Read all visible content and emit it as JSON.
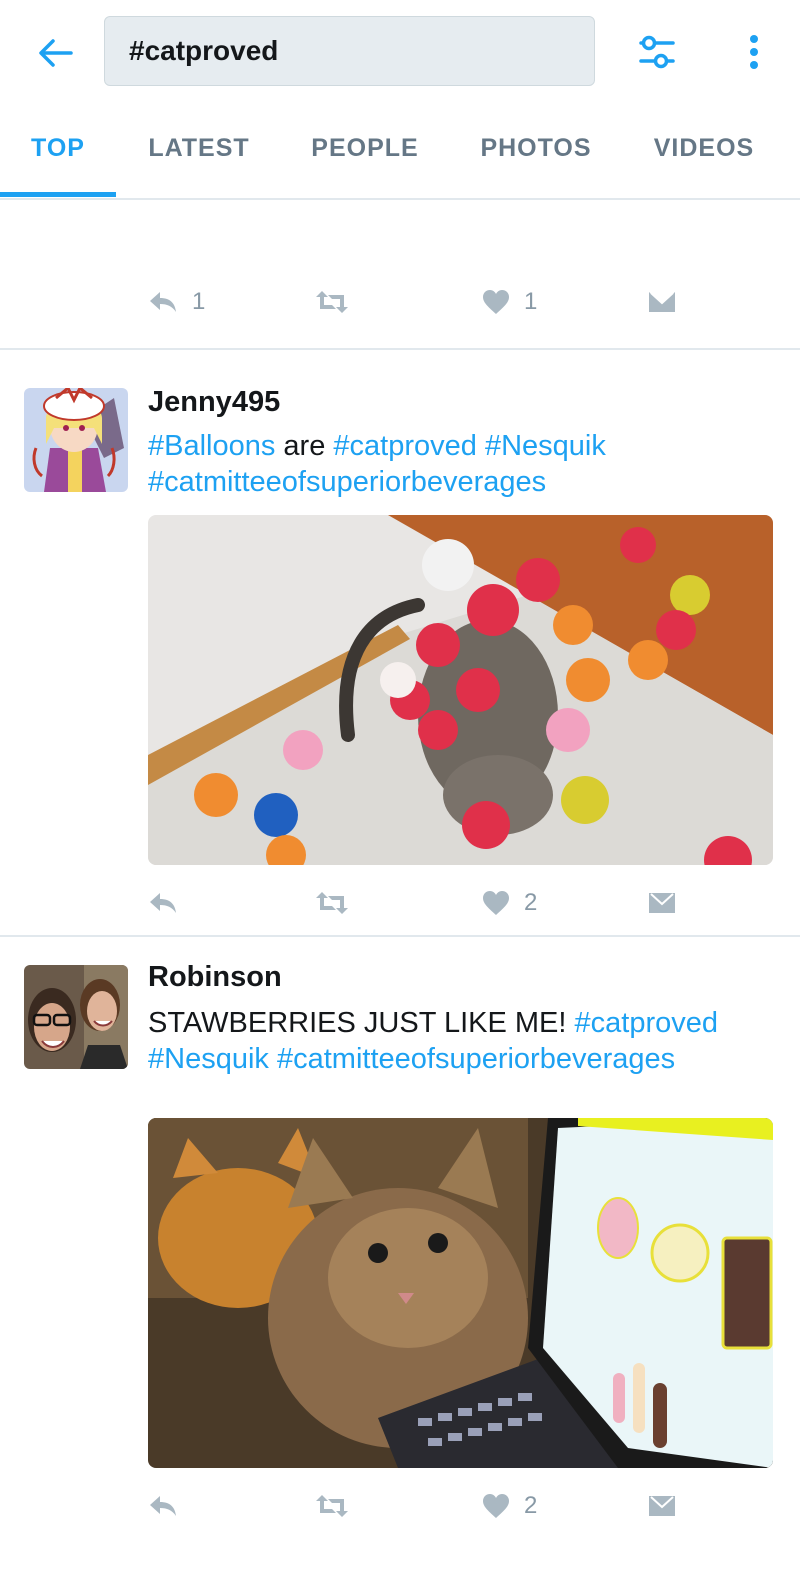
{
  "search": {
    "query": "#catproved"
  },
  "tabs": [
    {
      "label": "TOP",
      "active": true
    },
    {
      "label": "LATEST",
      "active": false
    },
    {
      "label": "PEOPLE",
      "active": false
    },
    {
      "label": "PHOTOS",
      "active": false
    },
    {
      "label": "VIDEOS",
      "active": false
    }
  ],
  "icons": {
    "back": "back-arrow-icon",
    "filter": "filter-sliders-icon",
    "more": "more-vertical-icon",
    "reply": "reply-icon",
    "retweet": "retweet-icon",
    "like": "heart-icon",
    "dm": "direct-message-icon"
  },
  "colors": {
    "accent": "#1da1f2",
    "muted": "#8899a6",
    "divider": "#e1e8ed"
  },
  "tweets": [
    {
      "actions": {
        "reply_count": "1",
        "retweet_count": "",
        "like_count": "1"
      }
    },
    {
      "username": "Jenny495",
      "text_parts": [
        {
          "text": " #Balloons",
          "hashtag": true
        },
        {
          "text": " are ",
          "hashtag": false
        },
        {
          "text": "#catproved",
          "hashtag": true
        },
        {
          "text": " ",
          "hashtag": false
        },
        {
          "text": "#Nesquik",
          "hashtag": true
        },
        {
          "text": " #catmitteeofsuperiorbeverages",
          "hashtag": true
        }
      ],
      "actions": {
        "reply_count": "",
        "retweet_count": "",
        "like_count": "2"
      }
    },
    {
      "username": "Robinson",
      "text_parts": [
        {
          "text": "STAWBERRIES JUST LIKE ME! ",
          "hashtag": false
        },
        {
          "text": "#catproved",
          "hashtag": true
        },
        {
          "text": " #Nesquik",
          "hashtag": true
        },
        {
          "text": " ",
          "hashtag": false
        },
        {
          "text": "#catmitteeofsuperiorbeverages",
          "hashtag": true
        }
      ],
      "actions": {
        "reply_count": "",
        "retweet_count": "",
        "like_count": "2"
      }
    }
  ]
}
